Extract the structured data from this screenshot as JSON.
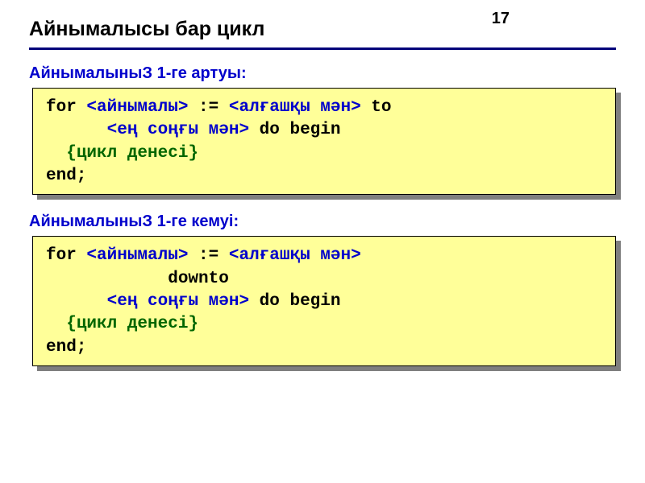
{
  "page_number": "17",
  "title": "Айнымалысы бар цикл",
  "section1": {
    "label": "АйнымалыныЗ 1-ге артуы:",
    "code": {
      "l1a": "for ",
      "l1b": "<айнымалы>",
      "l1c": " := ",
      "l1d": "<алғашқы мән>",
      "l1e": " to",
      "l2a": "      ",
      "l2b": "<ең соңғы мән>",
      "l2c": " do begin",
      "l3a": "  ",
      "l3b": "{цикл денесі}",
      "l4": "end;"
    }
  },
  "section2": {
    "label": "АйнымалыныЗ 1-ге кемуі:",
    "code": {
      "l1a": "for ",
      "l1b": "<айнымалы>",
      "l1c": " := ",
      "l1d": "<алғашқы мән>",
      "l2a": "            downto",
      "l3a": "      ",
      "l3b": "<ең соңғы мән>",
      "l3c": " do begin",
      "l4a": "  ",
      "l4b": "{цикл денесі}",
      "l5": "end;"
    }
  }
}
